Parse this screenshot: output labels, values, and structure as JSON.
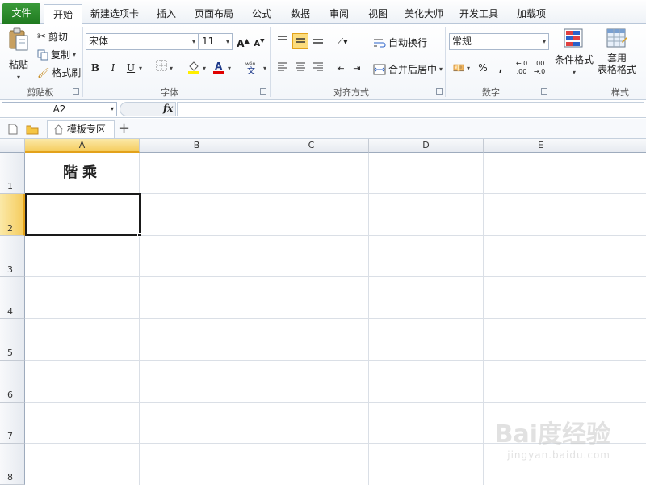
{
  "tabs": {
    "file": "文件",
    "home": "开始",
    "new_tab": "新建选项卡",
    "insert": "插入",
    "layout": "页面布局",
    "formula": "公式",
    "data": "数据",
    "review": "审阅",
    "view": "视图",
    "beautify": "美化大师",
    "developer": "开发工具",
    "addins": "加载项"
  },
  "clipboard": {
    "paste": "粘贴",
    "cut": "剪切",
    "copy": "复制",
    "format_painter": "格式刷",
    "group_label": "剪贴板"
  },
  "font": {
    "name": "宋体",
    "size": "11",
    "bold": "B",
    "italic": "I",
    "underline": "U",
    "group_label": "字体"
  },
  "alignment": {
    "wrap_text": "自动换行",
    "merge_center": "合并后居中",
    "group_label": "对齐方式"
  },
  "number": {
    "format": "常规",
    "percent": "%",
    "comma": ",",
    "group_label": "数字"
  },
  "styles": {
    "conditional": "条件格式",
    "table_format": "套用\n表格格式",
    "group_label": "样式"
  },
  "formula_bar": {
    "name_box": "A2",
    "fx": "fx",
    "value": ""
  },
  "doc_tabs": {
    "template_zone": "模板专区",
    "add": "+"
  },
  "sheet": {
    "columns": [
      "A",
      "B",
      "C",
      "D",
      "E"
    ],
    "rows": [
      "1",
      "2",
      "3",
      "4",
      "5",
      "6",
      "7",
      "8"
    ],
    "cell_a1": "階乘",
    "active_cell": "A2"
  },
  "watermark": {
    "brand": "Bai度经验",
    "url": "jingyan.baidu.com"
  },
  "colors": {
    "file_tab": "#2a8a2a",
    "selection": "#f5cc5e",
    "active_border": "#1a1a1a"
  }
}
